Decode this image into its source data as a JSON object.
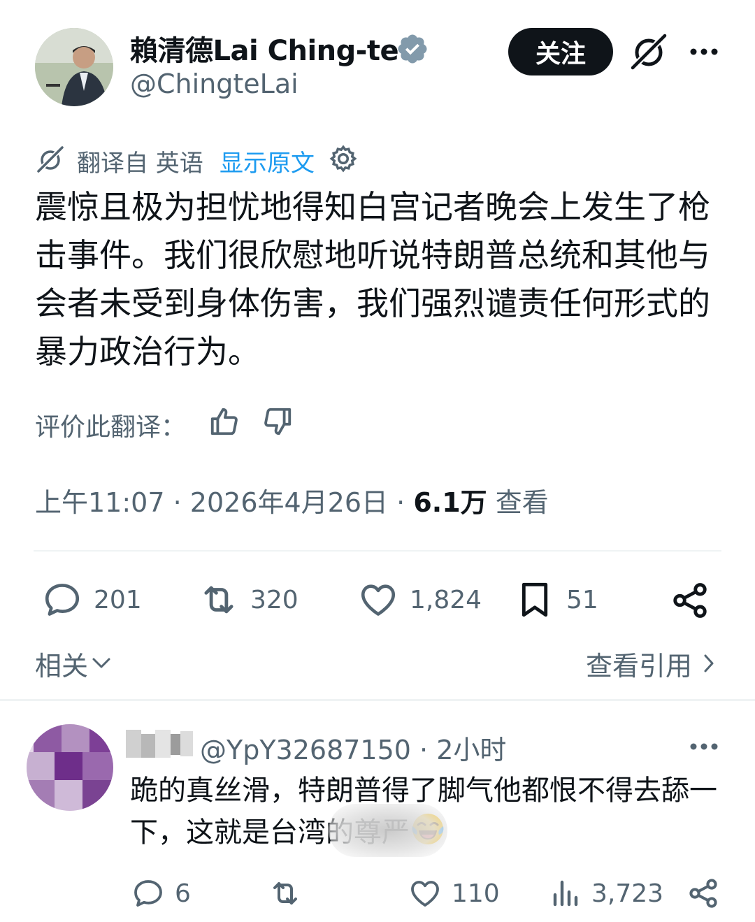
{
  "tweet": {
    "author_name": "賴清德Lai Ching-te",
    "handle": "@ChingteLai",
    "follow_label": "关注",
    "translation_note": "翻译自 英语",
    "show_original": "显示原文",
    "text": "震惊且极为担忧地得知白宫记者晚会上发生了枪击事件。我们很欣慰地听说特朗普总统和其他与会者未受到身体伤害，我们强烈谴责任何形式的暴力政治行为。",
    "rate_label": "评价此翻译：",
    "time": "上午11:07",
    "date": "2026年4月26日",
    "dot": "·",
    "views_count": "6.1万",
    "views_label": "查看",
    "replies": "201",
    "reposts": "320",
    "likes": "1,824",
    "bookmarks": "51",
    "related_label": "相关",
    "quotes_label": "查看引用"
  },
  "reply": {
    "handle_time": "@YpY32687150 · 2小时",
    "text_before_emoji": "跪的真丝滑，特朗普得了脚气他都恨不得去舔一下，这就是台湾的尊严",
    "replies": "6",
    "likes": "110",
    "views": "3,723"
  },
  "icons": {
    "verified": "verified-badge-icon",
    "grok": "grok-icon",
    "more": "more-icon",
    "translate": "translate-icon",
    "gear": "gear-icon",
    "thumbs_up": "thumbs-up-icon",
    "thumbs_down": "thumbs-down-icon",
    "reply": "reply-icon",
    "repost": "repost-icon",
    "like": "heart-icon",
    "bookmark": "bookmark-icon",
    "share": "share-icon",
    "views": "views-icon",
    "emoji": "laughing-tears-emoji"
  },
  "colors": {
    "accent": "#1d9bf0",
    "text": "#0f1419",
    "muted": "#536471",
    "verified": "#829aab"
  }
}
